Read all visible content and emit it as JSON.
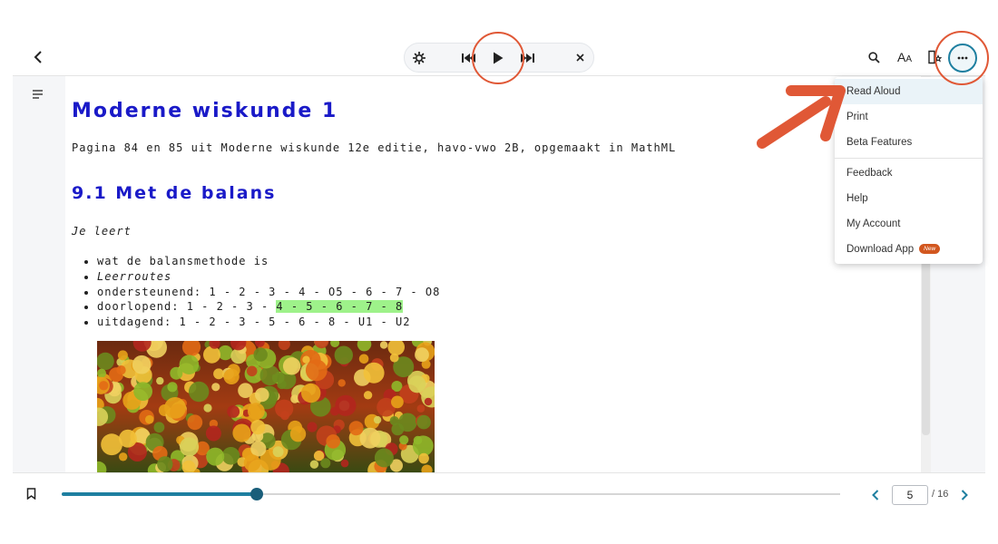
{
  "toolbar": {
    "back_icon": "chevron-left-icon",
    "player": {
      "settings_icon": "gear-icon",
      "prev_icon": "skip-previous-icon",
      "play_icon": "play-icon",
      "next_icon": "skip-next-icon",
      "close_icon": "close-icon"
    },
    "right": {
      "search_icon": "search-icon",
      "text_size_icon": "text-size-icon",
      "text_size_label": "AA",
      "accessibility_icon": "page-settings-icon",
      "more_icon": "more-horizontal-icon"
    }
  },
  "menu": {
    "items": [
      {
        "label": "Read Aloud",
        "active": true
      },
      {
        "label": "Print"
      },
      {
        "label": "Beta Features"
      },
      {
        "label": "Feedback"
      },
      {
        "label": "Help"
      },
      {
        "label": "My Account"
      },
      {
        "label": "Download App",
        "badge": "New"
      }
    ]
  },
  "document": {
    "title": "Moderne wiskunde 1",
    "subtitle": "Pagina 84 en 85 uit Moderne wiskunde 12e editie, havo-vwo 2B, opgemaakt in MathML",
    "section": "9.1 Met de balans",
    "learn_heading": "Je leert",
    "goals": [
      "wat de balansmethode is",
      "Leerroutes",
      "ondersteunend: 1 - 2 - 3 - 4 - O5 - 6 - 7 - O8",
      "doorlopend: 1 - 2 - 3 - ",
      "uitdagend: 1 - 2 - 3 - 5 - 6 - 8 - U1 - U2"
    ],
    "goal_highlight": "4 - 5 - 6 - 7 - 8",
    "image_description_icon": "fruit-market-photo"
  },
  "footer": {
    "bookmark_icon": "bookmark-icon",
    "progress": 0.25,
    "current_page": "5",
    "total_pages": "/ 16",
    "prev_icon": "chevron-left-icon",
    "next_icon": "chevron-right-icon"
  },
  "colors": {
    "accent": "#1e7fa0",
    "heading": "#1a1ac8",
    "highlight": "#9ef28a",
    "annotation": "#e05836",
    "badge": "#d2571f"
  }
}
